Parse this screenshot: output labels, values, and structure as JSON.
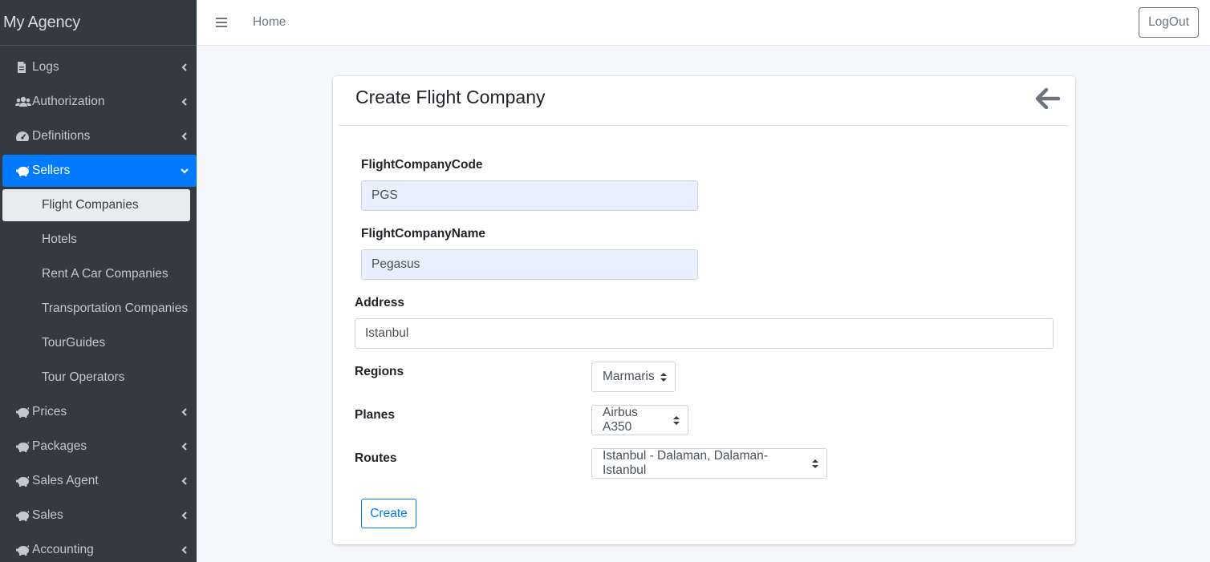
{
  "brand": {
    "title": "My Agency"
  },
  "sidebar": {
    "items": [
      {
        "label": "Logs",
        "icon": "file-icon"
      },
      {
        "label": "Authorization",
        "icon": "users-icon"
      },
      {
        "label": "Definitions",
        "icon": "gauge-icon"
      },
      {
        "label": "Sellers",
        "icon": "piggy-bank-icon",
        "active": true
      },
      {
        "label": "Prices",
        "icon": "piggy-bank-icon"
      },
      {
        "label": "Packages",
        "icon": "piggy-bank-icon"
      },
      {
        "label": "Sales Agent",
        "icon": "piggy-bank-icon"
      },
      {
        "label": "Sales",
        "icon": "piggy-bank-icon"
      },
      {
        "label": "Accounting",
        "icon": "piggy-bank-icon"
      }
    ],
    "sellers_sub": [
      {
        "label": "Flight Companies",
        "active": true
      },
      {
        "label": "Hotels"
      },
      {
        "label": "Rent A Car Companies"
      },
      {
        "label": "Transportation Companies"
      },
      {
        "label": "TourGuides"
      },
      {
        "label": "Tour Operators"
      }
    ]
  },
  "topbar": {
    "home_label": "Home",
    "logout_label": "LogOut"
  },
  "form": {
    "title": "Create Flight Company",
    "code_label": "FlightCompanyCode",
    "code_value": "PGS",
    "name_label": "FlightCompanyName",
    "name_value": "Pegasus",
    "address_label": "Address",
    "address_value": "Istanbul",
    "regions_label": "Regions",
    "regions_value": "Marmaris",
    "planes_label": "Planes",
    "planes_value": "Airbus A350",
    "routes_label": "Routes",
    "routes_value": "Istanbul - Dalaman, Dalaman-Istanbul",
    "create_label": "Create"
  },
  "colors": {
    "sidebar_bg": "#343a40",
    "accent": "#007bff",
    "autofill": "#e8f0fe"
  }
}
